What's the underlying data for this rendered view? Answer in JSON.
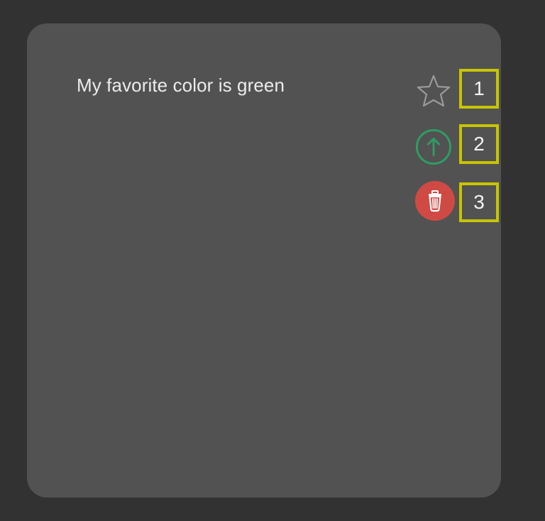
{
  "note": {
    "text": "My favorite color is green"
  },
  "actions": [
    {
      "icon": "star-icon",
      "marker": "1"
    },
    {
      "icon": "arrow-up-circle-icon",
      "marker": "2",
      "color": "#2e9d64"
    },
    {
      "icon": "trash-icon",
      "marker": "3",
      "color": "#cf4a44"
    }
  ],
  "colors": {
    "background": "#323232",
    "card": "#525252",
    "marker_border": "#c8c400"
  }
}
